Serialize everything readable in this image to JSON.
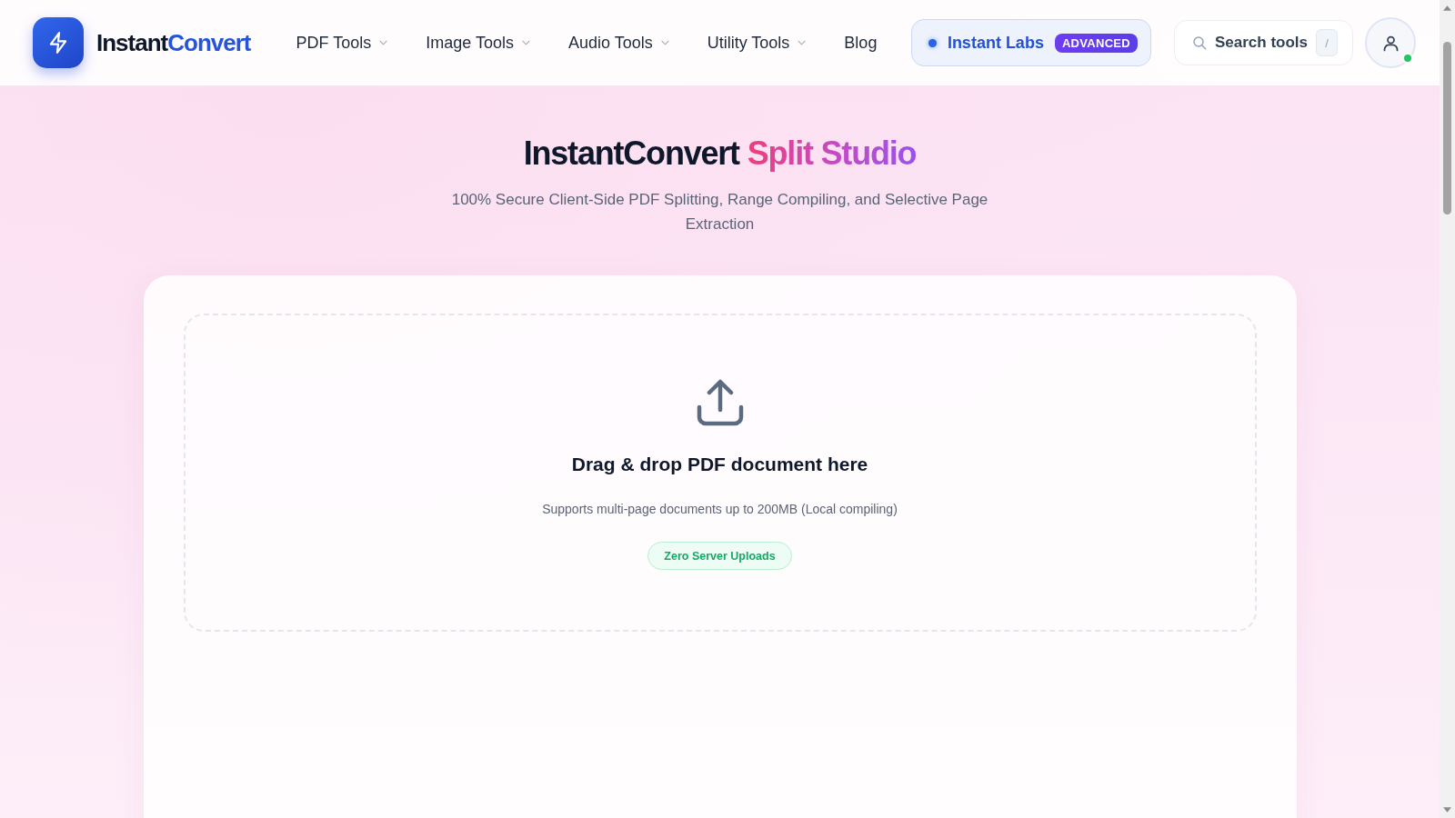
{
  "header": {
    "logo": {
      "name": "Instant",
      "accent": "Convert"
    },
    "nav": [
      {
        "label": "PDF Tools",
        "kind": "menu"
      },
      {
        "label": "Image Tools",
        "kind": "menu"
      },
      {
        "label": "Audio Tools",
        "kind": "menu"
      },
      {
        "label": "Utility Tools",
        "kind": "menu"
      },
      {
        "label": "Blog",
        "kind": "link"
      }
    ],
    "labs": {
      "label": "Instant Labs",
      "badge": "ADVANCED"
    },
    "search": {
      "placeholder": "Search tools",
      "shortcut": "/"
    },
    "user": {
      "online": true
    }
  },
  "hero": {
    "title": "InstantConvert",
    "highlight": "Split Studio",
    "subtitle": "100% Secure Client-Side PDF Splitting, Range Compiling, and Selective Page Extraction"
  },
  "dropzone": {
    "heading": "Drag & drop PDF document here",
    "note": "Supports multi-page documents up to 200MB (Local compiling)",
    "badge": "Zero Server Uploads"
  }
}
